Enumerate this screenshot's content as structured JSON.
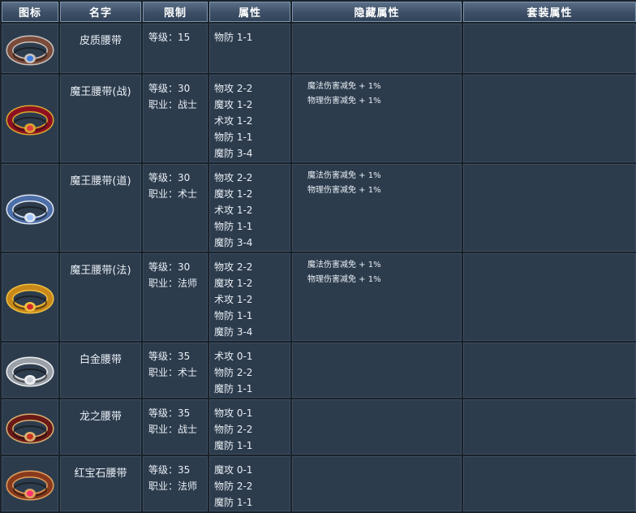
{
  "headers": [
    "图标",
    "名字",
    "限制",
    "属性",
    "隐藏属性",
    "套装属性"
  ],
  "rows": [
    {
      "icon": "leather-belt-icon",
      "name": "皮质腰带",
      "req": [
        "等级：15"
      ],
      "attrs": [
        "物防 1-1"
      ],
      "hidden": [],
      "set": ""
    },
    {
      "icon": "demon-king-belt-warrior-icon",
      "name": "魔王腰带(战)",
      "req": [
        "等级：30",
        "职业：战士"
      ],
      "attrs": [
        "物攻 2-2",
        "魔攻 1-2",
        "术攻 1-2",
        "物防 1-1",
        "魔防 3-4"
      ],
      "hidden": [
        "魔法伤害减免 + 1%",
        "物理伤害减免 + 1%"
      ],
      "set": ""
    },
    {
      "icon": "demon-king-belt-taoist-icon",
      "name": "魔王腰带(道)",
      "req": [
        "等级：30",
        "职业：术士"
      ],
      "attrs": [
        "物攻 2-2",
        "魔攻 1-2",
        "术攻 1-2",
        "物防 1-1",
        "魔防 3-4"
      ],
      "hidden": [
        "魔法伤害减免 + 1%",
        "物理伤害减免 + 1%"
      ],
      "set": ""
    },
    {
      "icon": "demon-king-belt-mage-icon",
      "name": "魔王腰带(法)",
      "req": [
        "等级：30",
        "职业：法师"
      ],
      "attrs": [
        "物攻 2-2",
        "魔攻 1-2",
        "术攻 1-2",
        "物防 1-1",
        "魔防 3-4"
      ],
      "hidden": [
        "魔法伤害减免 + 1%",
        "物理伤害减免 + 1%"
      ],
      "set": ""
    },
    {
      "icon": "platinum-belt-icon",
      "name": "白金腰带",
      "req": [
        "等级：35",
        "职业：术士"
      ],
      "attrs": [
        "术攻 0-1",
        "物防 2-2",
        "魔防 1-1"
      ],
      "hidden": [],
      "set": ""
    },
    {
      "icon": "dragon-belt-icon",
      "name": "龙之腰带",
      "req": [
        "等级：35",
        "职业：战士"
      ],
      "attrs": [
        "物攻 0-1",
        "物防 2-2",
        "魔防 1-1"
      ],
      "hidden": [],
      "set": ""
    },
    {
      "icon": "ruby-belt-icon",
      "name": "红宝石腰带",
      "req": [
        "等级：35",
        "职业：法师"
      ],
      "attrs": [
        "魔攻 0-1",
        "物防 2-2",
        "魔防 1-1"
      ],
      "hidden": [],
      "set": ""
    }
  ],
  "icon_colors": {
    "leather-belt-icon": {
      "band": "#7a4a3a",
      "edge": "#c9c2bd",
      "gem": "#3a7be0"
    },
    "demon-king-belt-warrior-icon": {
      "band": "#8e1020",
      "edge": "#d8a830",
      "gem": "#e04040"
    },
    "demon-king-belt-taoist-icon": {
      "band": "#4d6fa8",
      "edge": "#dfe6f0",
      "gem": "#9ec3ff"
    },
    "demon-king-belt-mage-icon": {
      "band": "#c8881a",
      "edge": "#f0c040",
      "gem": "#d02a2a"
    },
    "platinum-belt-icon": {
      "band": "#9aa0a8",
      "edge": "#eef0f2",
      "gem": "#c8ccd2"
    },
    "dragon-belt-icon": {
      "band": "#6a1a16",
      "edge": "#d8b070",
      "gem": "#c83020"
    },
    "ruby-belt-icon": {
      "band": "#8a3a1c",
      "edge": "#e0a060",
      "gem": "#ff3070"
    }
  }
}
